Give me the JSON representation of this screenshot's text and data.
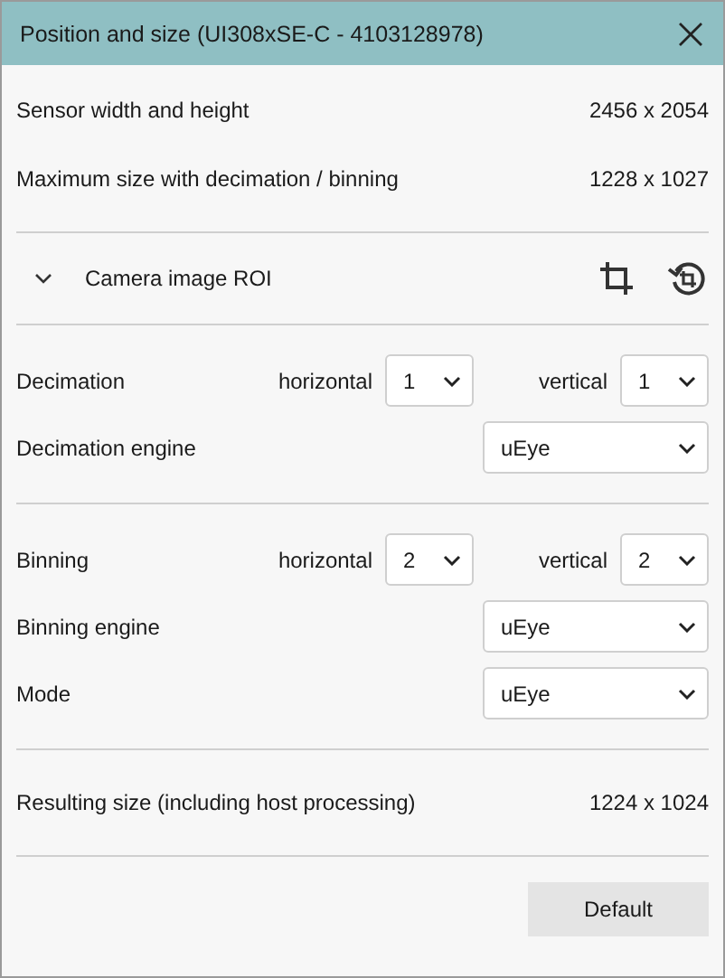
{
  "window": {
    "title": "Position and size (UI308xSE-C - 4103128978)"
  },
  "sections": [
    {
      "rows": [
        {
          "kind": "info",
          "label": "Sensor width and height",
          "value": "2456 x 2054"
        },
        {
          "kind": "info",
          "label": "Maximum size with decimation / binning",
          "value": "1228 x 1027"
        }
      ]
    },
    {
      "rows": [
        {
          "kind": "roi",
          "label": "Camera image ROI",
          "expanded": true
        }
      ]
    },
    {
      "rows": [
        {
          "kind": "pair",
          "label": "Decimation",
          "h_label": "horizontal",
          "h_value": "1",
          "v_label": "vertical",
          "v_value": "1"
        },
        {
          "kind": "select",
          "label": "Decimation engine",
          "value": "uEye"
        }
      ]
    },
    {
      "rows": [
        {
          "kind": "pair",
          "label": "Binning",
          "h_label": "horizontal",
          "h_value": "2",
          "v_label": "vertical",
          "v_value": "2"
        },
        {
          "kind": "select",
          "label": "Binning engine",
          "value": "uEye"
        },
        {
          "kind": "select",
          "label": "Mode",
          "value": "uEye"
        }
      ]
    },
    {
      "rows": [
        {
          "kind": "info",
          "label": "Resulting size (including host processing)",
          "value": "1224 x 1024"
        }
      ]
    }
  ],
  "buttons": [
    "Default"
  ]
}
